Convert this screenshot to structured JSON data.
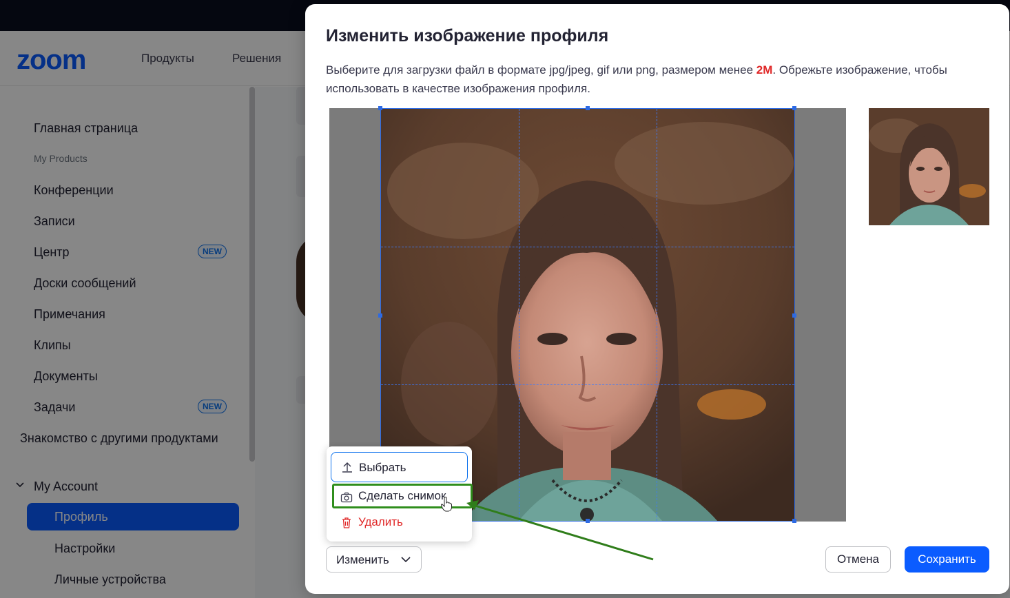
{
  "header": {
    "logo": "zoom",
    "nav": [
      "Продукты",
      "Решения"
    ]
  },
  "sidebar": {
    "items": [
      {
        "label": "Главная страница"
      },
      {
        "label": "My Products",
        "small": true
      },
      {
        "label": "Конференции"
      },
      {
        "label": "Записи"
      },
      {
        "label": "Центр",
        "badge": "NEW"
      },
      {
        "label": "Доски сообщений"
      },
      {
        "label": "Примечания"
      },
      {
        "label": "Клипы"
      },
      {
        "label": "Документы"
      },
      {
        "label": "Задачи",
        "badge": "NEW"
      },
      {
        "label": "Знакомство с другими продуктами"
      },
      {
        "label": "My Account"
      },
      {
        "label": "Профиль",
        "active": true
      },
      {
        "label": "Настройки"
      },
      {
        "label": "Личные устройства"
      }
    ]
  },
  "modal": {
    "title": "Изменить изображение профиля",
    "desc_before": "Выберите для загрузки файл в формате jpg/jpeg, gif или png, размером менее ",
    "desc_size": "2M",
    "desc_after": ". Обрежьте изображение, чтобы использовать в качестве изображения профиля.",
    "menu": {
      "choose": "Выбрать",
      "snapshot": "Сделать снимок",
      "delete": "Удалить"
    },
    "change_button": "Изменить",
    "cancel_button": "Отмена",
    "save_button": "Сохранить"
  },
  "colors": {
    "accent": "#0b5cff",
    "danger": "#e02828",
    "highlight": "#2f8e1c",
    "badge": "#0e72ed"
  },
  "icons": [
    "upload-icon",
    "camera-icon",
    "trash-icon",
    "chevron-down-icon",
    "hand-cursor-icon",
    "chevron-down-expand-icon"
  ]
}
